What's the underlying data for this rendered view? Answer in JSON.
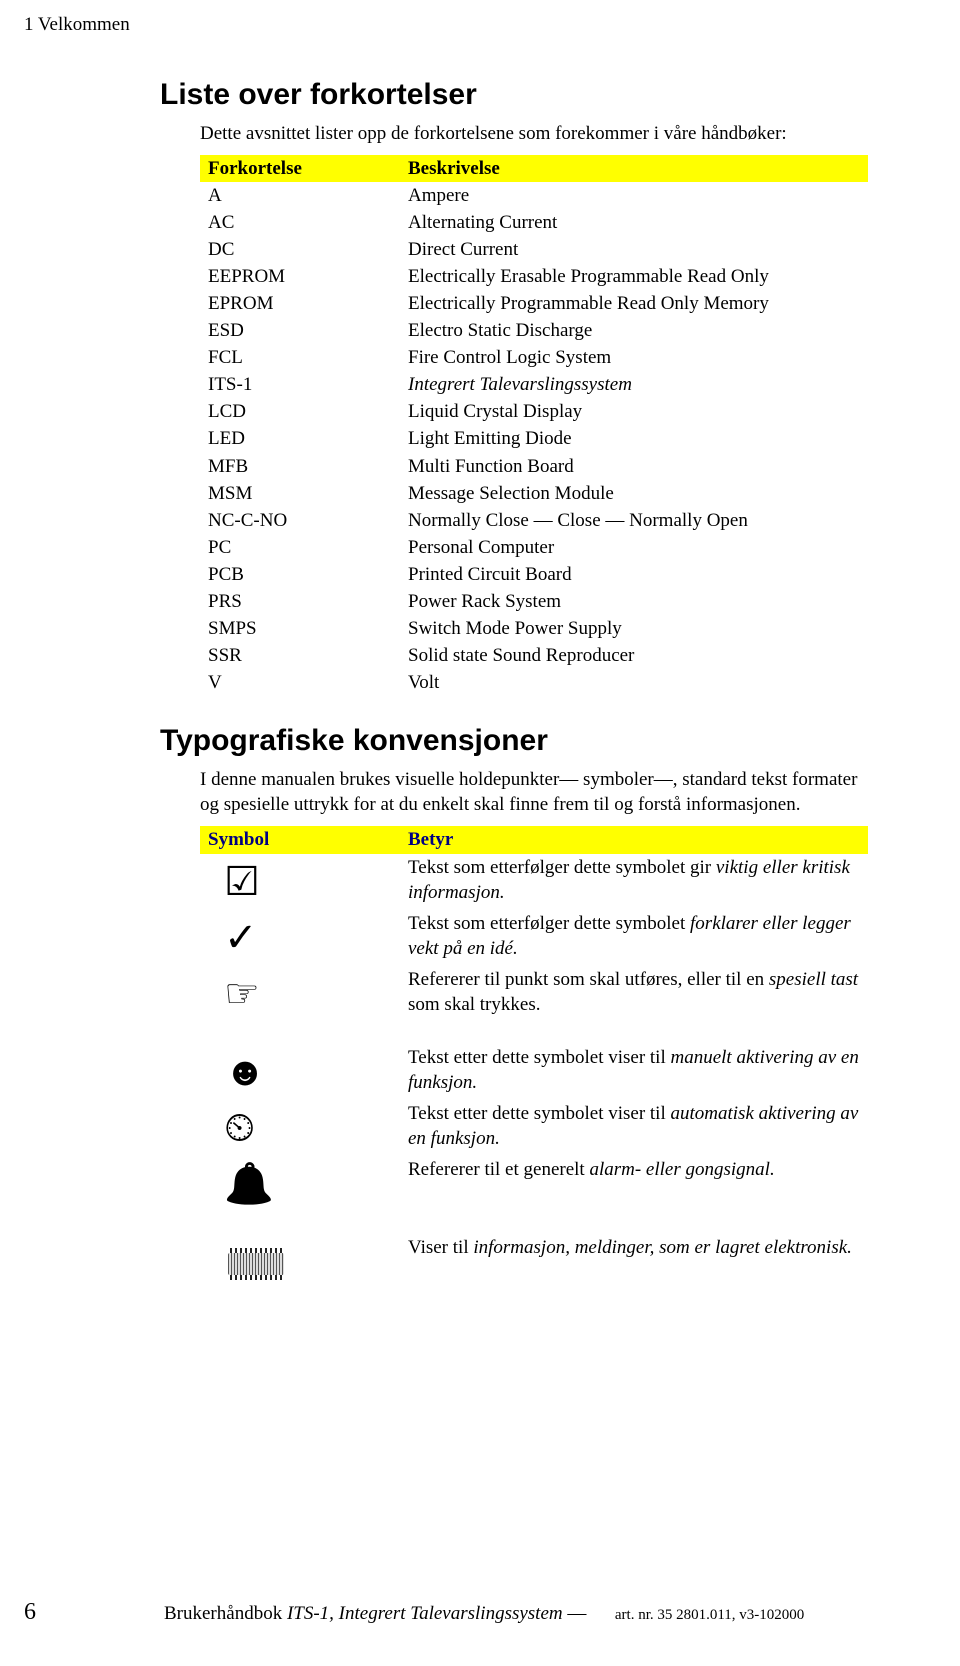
{
  "header": {
    "chapter": "1 Velkommen"
  },
  "abbr_section": {
    "title": "Liste over forkortelser",
    "intro": "Dette avsnittet lister opp de forkortelsene som forekommer i våre håndbøker:",
    "col1_header": "Forkortelse",
    "col2_header": "Beskrivelse",
    "rows": [
      {
        "abbr": "A",
        "desc": "Ampere"
      },
      {
        "abbr": "AC",
        "desc": "Alternating Current"
      },
      {
        "abbr": "DC",
        "desc": "Direct Current"
      },
      {
        "abbr": "EEPROM",
        "desc": "Electrically Erasable Programmable Read Only"
      },
      {
        "abbr": "EPROM",
        "desc": "Electrically Programmable Read Only Memory"
      },
      {
        "abbr": "ESD",
        "desc": "Electro Static Discharge"
      },
      {
        "abbr": "FCL",
        "desc": "Fire Control Logic System"
      },
      {
        "abbr": "ITS-1",
        "desc": "Integrert Talevarslingssystem",
        "italic": true
      },
      {
        "abbr": "LCD",
        "desc": "Liquid Crystal Display"
      },
      {
        "abbr": "LED",
        "desc": "Light Emitting Diode"
      },
      {
        "abbr": "MFB",
        "desc": "Multi Function Board"
      },
      {
        "abbr": "MSM",
        "desc": "Message Selection Module"
      },
      {
        "abbr": "NC-C-NO",
        "desc": "Normally Close — Close — Normally Open"
      },
      {
        "abbr": "PC",
        "desc": "Personal Computer"
      },
      {
        "abbr": "PCB",
        "desc": "Printed Circuit Board"
      },
      {
        "abbr": "PRS",
        "desc": "Power Rack System"
      },
      {
        "abbr": "SMPS",
        "desc": "Switch Mode Power Supply"
      },
      {
        "abbr": "SSR",
        "desc": "Solid state Sound Reproducer"
      },
      {
        "abbr": "V",
        "desc": "Volt"
      }
    ]
  },
  "typo_section": {
    "title": "Typografiske konvensjoner",
    "intro": "I denne manualen brukes visuelle holdepunkter— symboler—, standard tekst formater og spesielle uttrykk for at du enkelt skal finne frem til og forstå informasjonen.",
    "col1_header": "Symbol",
    "col2_header": "Betyr",
    "rows": [
      {
        "icon": "checkbox",
        "pre": "Tekst som etterfølger dette symbolet gir ",
        "em": "viktig eller kritisk informasjon.",
        "post": ""
      },
      {
        "icon": "checkmark",
        "pre": "Tekst som etterfølger dette symbolet ",
        "em": "forklarer eller legger vekt på en idé.",
        "post": ""
      },
      {
        "icon": "hand",
        "pre": "Refererer til punkt som skal utføres, eller til en ",
        "em": "spesiell tast",
        "post": " som skal trykkes."
      },
      {
        "icon": "face",
        "pre": "Tekst etter dette symbolet viser til ",
        "em": "manuelt aktivering av en funksjon.",
        "post": ""
      },
      {
        "icon": "clock",
        "pre": "Tekst etter dette symbolet viser til ",
        "em": "automatisk aktivering av en funksjon.",
        "post": ""
      },
      {
        "icon": "bell",
        "pre": "Refererer til et generelt ",
        "em": "alarm- eller gongsignal.",
        "post": ""
      },
      {
        "icon": "chip",
        "pre": "Viser til ",
        "em": "informasjon, meldinger, som er lagret elektronisk.",
        "post": ""
      }
    ]
  },
  "footer": {
    "page_num": "6",
    "center_pre": "Brukerhåndbok ",
    "center_em": "ITS-1, Integrert Talevarslingssystem",
    "center_post": " —",
    "right": "art. nr. 35 2801.011, v3-102000"
  }
}
